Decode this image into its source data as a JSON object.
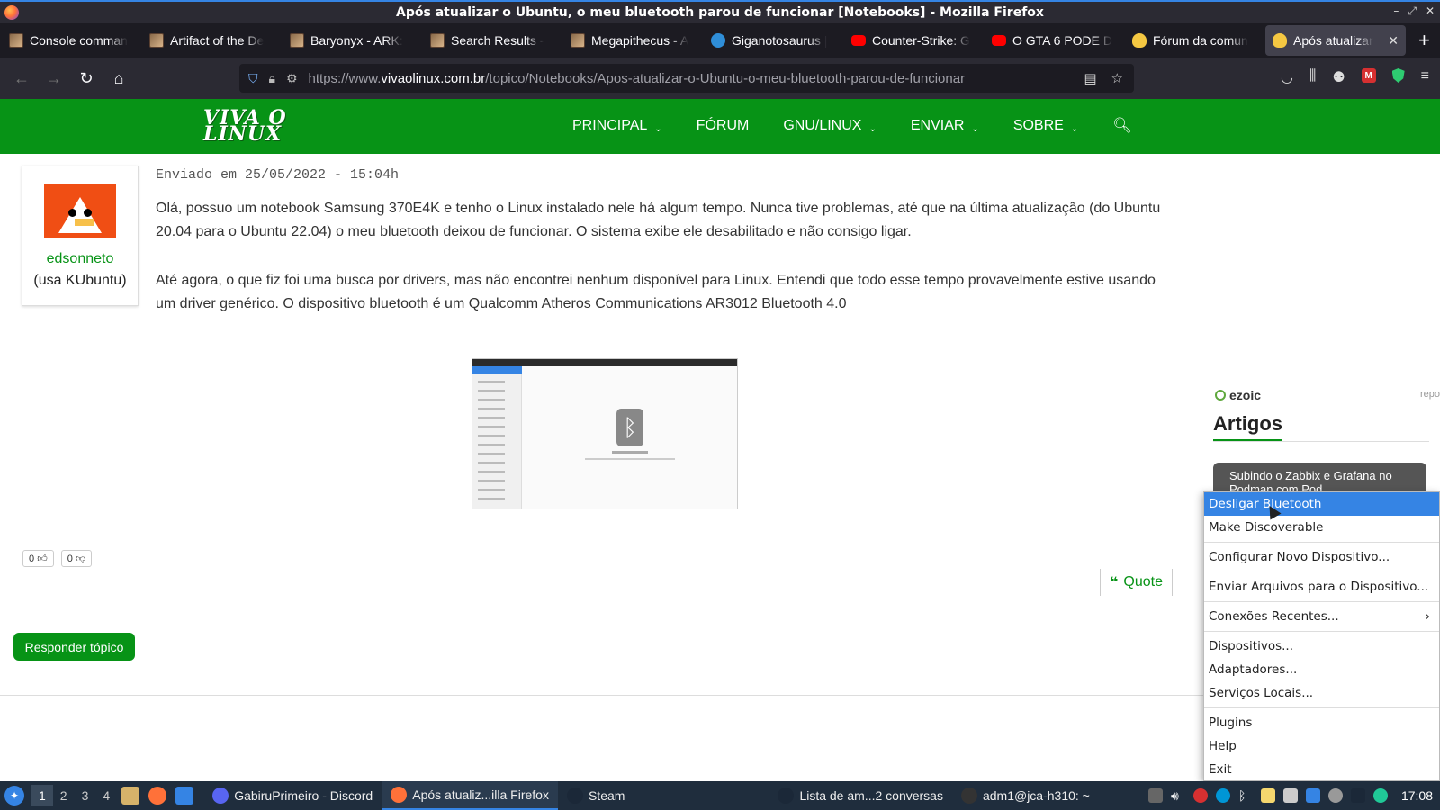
{
  "window": {
    "title": "Após atualizar o Ubuntu, o meu bluetooth parou de funcionar [Notebooks] - Mozilla Firefox"
  },
  "tabs": [
    {
      "label": "Console comman",
      "icon": "ark-icon"
    },
    {
      "label": "Artifact of the De",
      "icon": "ark-icon"
    },
    {
      "label": "Baryonyx - ARK:",
      "icon": "ark-icon"
    },
    {
      "label": "Search Results -",
      "icon": "ark-icon"
    },
    {
      "label": "Megapithecus - A",
      "icon": "ark-icon"
    },
    {
      "label": "Giganotosaurus |",
      "icon": "globe-icon"
    },
    {
      "label": "Counter-Strike: G",
      "icon": "youtube-icon"
    },
    {
      "label": "O GTA 6 PODE D",
      "icon": "youtube-icon"
    },
    {
      "label": "Fórum da comun",
      "icon": "tux-icon"
    },
    {
      "label": "Após atualizar",
      "icon": "tux-icon",
      "active": true
    }
  ],
  "urlbar": {
    "prefix": "https://www.",
    "host": "vivaolinux.com.br",
    "path": "/topico/Notebooks/Apos-atualizar-o-Ubuntu-o-meu-bluetooth-parou-de-funcionar"
  },
  "site": {
    "logo": [
      "VIVA O",
      "LINUX"
    ],
    "menu": [
      {
        "label": "PRINCIPAL",
        "chevron": true
      },
      {
        "label": "FÓRUM",
        "chevron": false
      },
      {
        "label": "GNU/LINUX",
        "chevron": true
      },
      {
        "label": "ENVIAR",
        "chevron": true
      },
      {
        "label": "SOBRE",
        "chevron": true
      }
    ],
    "chevron_glyph": "⌄",
    "search_glyph": "🔍︎"
  },
  "post": {
    "username": "edsonneto",
    "usertag": "(usa KUbuntu)",
    "date": "Enviado em 25/05/2022 - 15:04h",
    "paragraphs": [
      "Olá, possuo um notebook Samsung 370E4K e tenho o Linux instalado nele há algum tempo. Nunca tive problemas, até que na última atualização (do Ubuntu 20.04 para o Ubuntu 22.04) o meu bluetooth deixou de funcionar. O sistema exibe ele desabilitado e não consigo ligar.",
      "Até agora, o que fiz foi uma busca por drivers, mas não encontrei nenhum disponível para Linux. Entendi que todo esse tempo provavelmente estive usando um driver genérico. O dispositivo bluetooth é um Qualcomm Atheros Communications AR3012 Bluetooth 4.0"
    ],
    "upvotes": "0",
    "downvotes": "0",
    "quote_label": "Quote",
    "reply_label": "Responder tópico"
  },
  "sidebar": {
    "ezoic": "ezoic",
    "repo": "repo",
    "section_title": "Artigos",
    "article_card": "Subindo o Zabbix e Grafana no Podman com Pod"
  },
  "context_menu": [
    {
      "label": "Desligar Bluetooth",
      "highlighted": true
    },
    {
      "label": "Make Discoverable"
    },
    {
      "sep": true
    },
    {
      "label": "Configurar Novo Dispositivo..."
    },
    {
      "sep": true
    },
    {
      "label": "Enviar Arquivos para o Dispositivo..."
    },
    {
      "sep": true
    },
    {
      "label": "Conexões Recentes...",
      "submenu": true
    },
    {
      "sep": true
    },
    {
      "label": "Dispositivos..."
    },
    {
      "label": "Adaptadores..."
    },
    {
      "label": "Serviços Locais..."
    },
    {
      "sep": true
    },
    {
      "label": "Plugins"
    },
    {
      "label": "Help"
    },
    {
      "label": "Exit"
    }
  ],
  "taskbar": {
    "workspaces": [
      "1",
      "2",
      "3",
      "4"
    ],
    "tasks": [
      {
        "label": "GabiruPrimeiro - Discord",
        "icon": "discord-icon",
        "color": "#5865f2"
      },
      {
        "label": "Após atualiz...illa Firefox",
        "icon": "firefox-icon",
        "color": "#ff7139",
        "active": true
      },
      {
        "label": "Steam",
        "icon": "steam-icon",
        "color": "#1b2838"
      },
      {
        "label": "Lista de am...2 conversas",
        "icon": "steam-icon",
        "color": "#1b2838"
      },
      {
        "label": "adm1@jca-h310: ~",
        "icon": "terminal-icon",
        "color": "#333333"
      }
    ],
    "clock": "17:08"
  },
  "colors": {
    "site_green": "#079316",
    "menu_highlight": "#3584e4"
  }
}
